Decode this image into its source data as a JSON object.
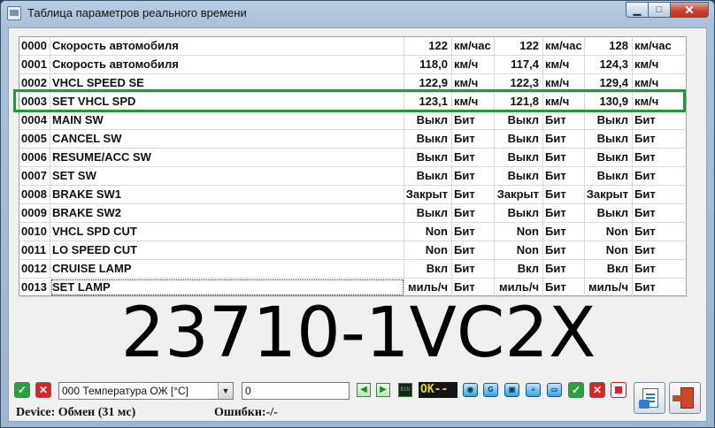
{
  "window": {
    "title": "Таблица параметров реального времени"
  },
  "table": {
    "rows": [
      {
        "id": "0000",
        "name": "Скорость автомобиля",
        "v1": "122",
        "u1": "км/час",
        "v2": "122",
        "u2": "км/час",
        "v3": "128",
        "u3": "км/час"
      },
      {
        "id": "0001",
        "name": "Скорость автомобиля",
        "v1": "118,0",
        "u1": "км/ч",
        "v2": "117,4",
        "u2": "км/ч",
        "v3": "124,3",
        "u3": "км/ч"
      },
      {
        "id": "0002",
        "name": "VHCL SPEED SE",
        "v1": "122,9",
        "u1": "км/ч",
        "v2": "122,3",
        "u2": "км/ч",
        "v3": "129,4",
        "u3": "км/ч"
      },
      {
        "id": "0003",
        "name": "SET VHCL SPD",
        "v1": "123,1",
        "u1": "км/ч",
        "v2": "121,8",
        "u2": "км/ч",
        "v3": "130,9",
        "u3": "км/ч"
      },
      {
        "id": "0004",
        "name": "MAIN SW",
        "v1": "Выкл",
        "u1": "Бит",
        "v2": "Выкл",
        "u2": "Бит",
        "v3": "Выкл",
        "u3": "Бит"
      },
      {
        "id": "0005",
        "name": "CANCEL SW",
        "v1": "Выкл",
        "u1": "Бит",
        "v2": "Выкл",
        "u2": "Бит",
        "v3": "Выкл",
        "u3": "Бит"
      },
      {
        "id": "0006",
        "name": "RESUME/ACC SW",
        "v1": "Выкл",
        "u1": "Бит",
        "v2": "Выкл",
        "u2": "Бит",
        "v3": "Выкл",
        "u3": "Бит"
      },
      {
        "id": "0007",
        "name": "SET SW",
        "v1": "Выкл",
        "u1": "Бит",
        "v2": "Выкл",
        "u2": "Бит",
        "v3": "Выкл",
        "u3": "Бит"
      },
      {
        "id": "0008",
        "name": "BRAKE SW1",
        "v1": "Закрыт",
        "u1": "Бит",
        "v2": "Закрыт",
        "u2": "Бит",
        "v3": "Закрыт",
        "u3": "Бит"
      },
      {
        "id": "0009",
        "name": "BRAKE SW2",
        "v1": "Выкл",
        "u1": "Бит",
        "v2": "Выкл",
        "u2": "Бит",
        "v3": "Выкл",
        "u3": "Бит"
      },
      {
        "id": "0010",
        "name": "VHCL SPD CUT",
        "v1": "Non",
        "u1": "Бит",
        "v2": "Non",
        "u2": "Бит",
        "v3": "Non",
        "u3": "Бит"
      },
      {
        "id": "0011",
        "name": "LO SPEED CUT",
        "v1": "Non",
        "u1": "Бит",
        "v2": "Non",
        "u2": "Бит",
        "v3": "Non",
        "u3": "Бит"
      },
      {
        "id": "0012",
        "name": "CRUISE LAMP",
        "v1": "Вкл",
        "u1": "Бит",
        "v2": "Вкл",
        "u2": "Бит",
        "v3": "Вкл",
        "u3": "Бит"
      },
      {
        "id": "0013",
        "name": "SET LAMP",
        "v1": "миль/ч",
        "u1": "Бит",
        "v2": "миль/ч",
        "u2": "Бит",
        "v3": "миль/ч",
        "u3": "Бит"
      }
    ],
    "highlight_color": "#1e9a3c"
  },
  "overlay_text": "23710-1VC2X",
  "toolbar": {
    "parameter_select": "000 Температура ОЖ [°C]",
    "value_input": "0",
    "status_indicator": "OK--"
  },
  "status": {
    "device": "Device: Обмен (31 мс)",
    "errors": "Ошибки:-/-"
  }
}
